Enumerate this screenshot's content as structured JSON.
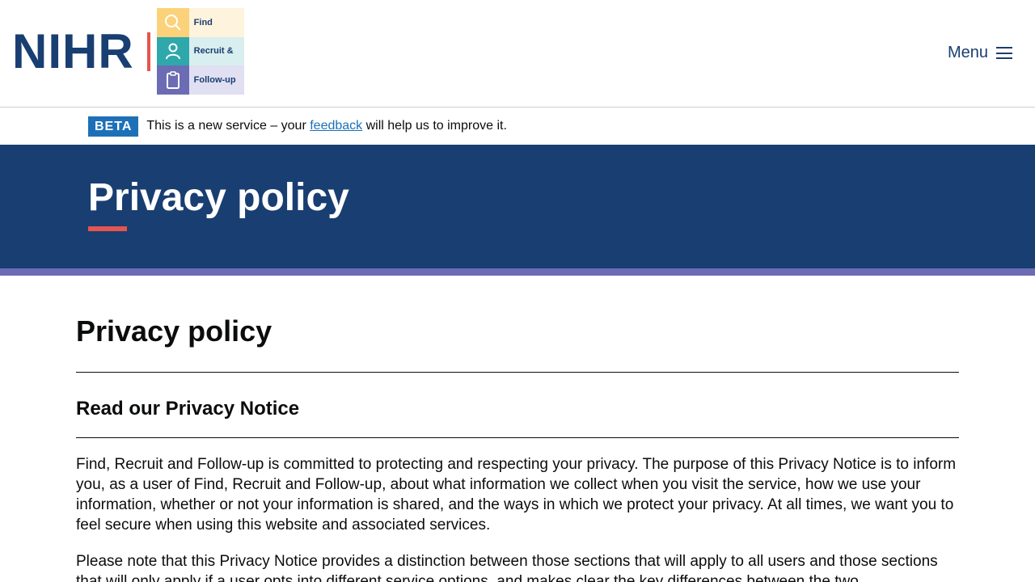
{
  "header": {
    "brand_text": "NIHR",
    "service_logo": {
      "rows": [
        {
          "label": "Find",
          "icon": "magnifier-icon"
        },
        {
          "label": "Recruit &",
          "icon": "person-icon"
        },
        {
          "label": "Follow-up",
          "icon": "clipboard-icon"
        }
      ]
    },
    "menu_label": "Menu"
  },
  "beta_banner": {
    "tag": "BETA",
    "text_before": "This is a new service – your ",
    "link_text": "feedback",
    "text_after": " will help us to improve it."
  },
  "hero": {
    "title": "Privacy policy"
  },
  "main": {
    "heading": "Privacy policy",
    "section_heading": "Read our Privacy Notice",
    "paragraphs": [
      "Find, Recruit and Follow-up is committed to protecting and respecting your privacy. The purpose of this Privacy Notice is to inform you, as a user of Find, Recruit and Follow-up, about what information we collect when you visit the service, how we use your information, whether or not your information is shared, and the ways in which we protect your privacy. At all times, we want you to feel secure when using this website and associated services.",
      "Please note that this Privacy Notice provides a distinction between those sections that will apply to all users and those sections that will only apply if a user opts into different service options, and makes clear the key differences between the two."
    ]
  },
  "colors": {
    "brand_navy": "#193e72",
    "accent_red": "#e5554f",
    "stripe_purple": "#6c6cb4",
    "link_blue": "#1d70b8"
  }
}
